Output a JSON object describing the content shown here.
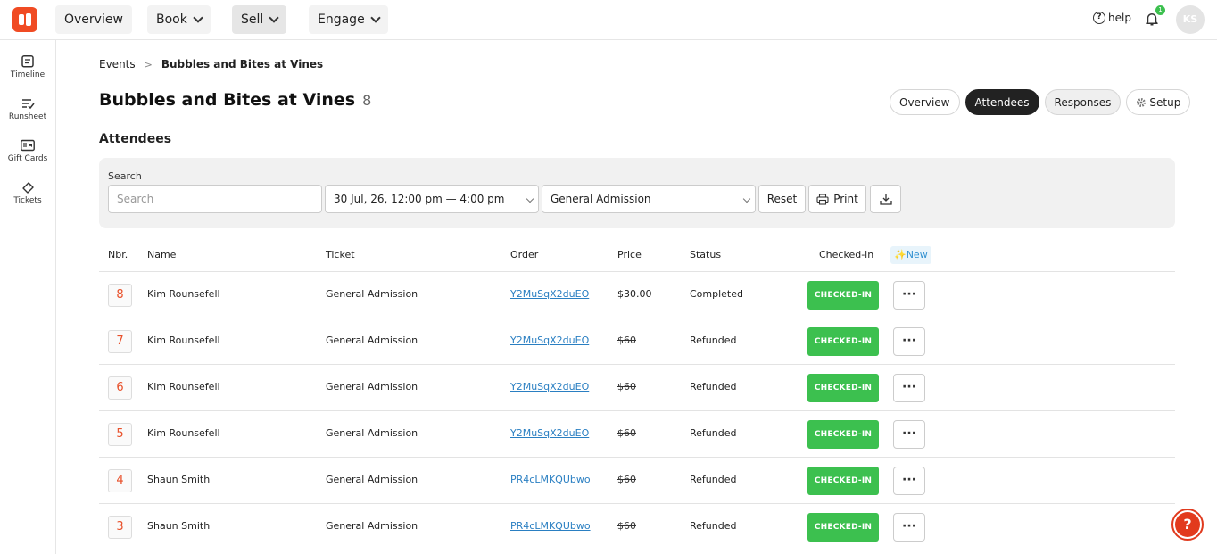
{
  "topnav": {
    "items": [
      {
        "label": "Overview",
        "has_chevron": false,
        "active": false
      },
      {
        "label": "Book",
        "has_chevron": true,
        "active": false
      },
      {
        "label": "Sell",
        "has_chevron": true,
        "active": true
      },
      {
        "label": "Engage",
        "has_chevron": true,
        "active": false
      }
    ],
    "help_label": "help",
    "notification_count": "1",
    "avatar_initials": "KS",
    "brand_color": "#f04b23"
  },
  "sidebar": {
    "items": [
      {
        "label": "Timeline",
        "icon": "timeline-icon"
      },
      {
        "label": "Runsheet",
        "icon": "runsheet-icon"
      },
      {
        "label": "Gift Cards",
        "icon": "gift-card-icon"
      },
      {
        "label": "Tickets",
        "icon": "ticket-icon"
      }
    ]
  },
  "breadcrumb": {
    "parent": "Events",
    "separator": ">",
    "current": "Bubbles and Bites at Vines"
  },
  "page": {
    "title": "Bubbles and Bites at Vines",
    "count": "8",
    "section_title": "Attendees"
  },
  "tabs": [
    {
      "label": "Overview",
      "active": false
    },
    {
      "label": "Attendees",
      "active": true
    },
    {
      "label": "Responses",
      "active": false
    },
    {
      "label": "Setup",
      "active": false,
      "icon": "gear-icon"
    }
  ],
  "filters": {
    "search_label": "Search",
    "search_placeholder": "Search",
    "session_value": "30 Jul, 26, 12:00 pm — 4:00 pm",
    "ticket_value": "General Admission",
    "reset_label": "Reset",
    "print_label": "Print"
  },
  "table": {
    "columns": {
      "nbr": "Nbr.",
      "name": "Name",
      "ticket": "Ticket",
      "order": "Order",
      "price": "Price",
      "status": "Status",
      "checked_in": "Checked-in",
      "new_badge": "✨New"
    },
    "rows": [
      {
        "nbr": "8",
        "name": "Kim Rounsefell",
        "ticket": "General Admission",
        "order": "Y2MuSqX2duEO",
        "price": "$30.00",
        "price_struck": false,
        "status": "Completed",
        "checkin_label": "CHECKED-IN",
        "more": "···"
      },
      {
        "nbr": "7",
        "name": "Kim Rounsefell",
        "ticket": "General Admission",
        "order": "Y2MuSqX2duEO",
        "price": "$60",
        "price_struck": true,
        "status": "Refunded",
        "checkin_label": "CHECKED-IN",
        "more": "···"
      },
      {
        "nbr": "6",
        "name": "Kim Rounsefell",
        "ticket": "General Admission",
        "order": "Y2MuSqX2duEO",
        "price": "$60",
        "price_struck": true,
        "status": "Refunded",
        "checkin_label": "CHECKED-IN",
        "more": "···"
      },
      {
        "nbr": "5",
        "name": "Kim Rounsefell",
        "ticket": "General Admission",
        "order": "Y2MuSqX2duEO",
        "price": "$60",
        "price_struck": true,
        "status": "Refunded",
        "checkin_label": "CHECKED-IN",
        "more": "···"
      },
      {
        "nbr": "4",
        "name": "Shaun Smith",
        "ticket": "General Admission",
        "order": "PR4cLMKQUbwo",
        "price": "$60",
        "price_struck": true,
        "status": "Refunded",
        "checkin_label": "CHECKED-IN",
        "more": "···"
      },
      {
        "nbr": "3",
        "name": "Shaun Smith",
        "ticket": "General Admission",
        "order": "PR4cLMKQUbwo",
        "price": "$60",
        "price_struck": true,
        "status": "Refunded",
        "checkin_label": "CHECKED-IN",
        "more": "···"
      }
    ]
  },
  "help_fab": {
    "label": "?"
  },
  "colors": {
    "checked_in": "#3cc04f",
    "link": "#2a7fc2",
    "accent": "#f04b23"
  }
}
